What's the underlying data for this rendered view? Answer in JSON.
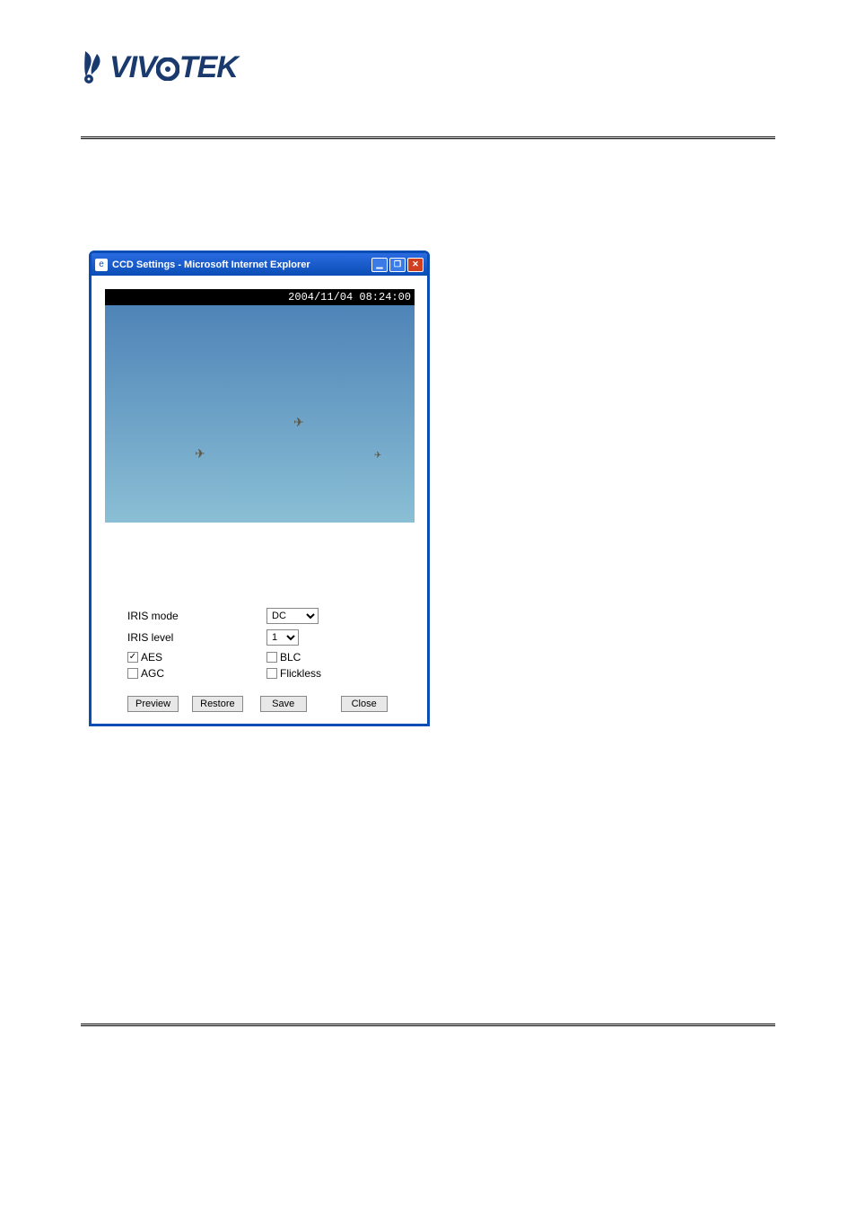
{
  "brand": {
    "name": "VIVOTEK"
  },
  "window": {
    "title": "CCD Settings - Microsoft Internet Explorer",
    "controls": {
      "minimize": "_",
      "maximize": "□",
      "close": "×"
    },
    "video": {
      "timestamp": "2004/11/04 08:24:00"
    },
    "settings": {
      "iris_mode_label": "IRIS mode",
      "iris_mode_value": "DC",
      "iris_level_label": "IRIS level",
      "iris_level_value": "1",
      "aes_label": "AES",
      "aes_checked": true,
      "blc_label": "BLC",
      "blc_checked": false,
      "agc_label": "AGC",
      "agc_checked": false,
      "flickless_label": "Flickless",
      "flickless_checked": false
    },
    "buttons": {
      "preview": "Preview",
      "restore": "Restore",
      "save": "Save",
      "close": "Close"
    }
  }
}
